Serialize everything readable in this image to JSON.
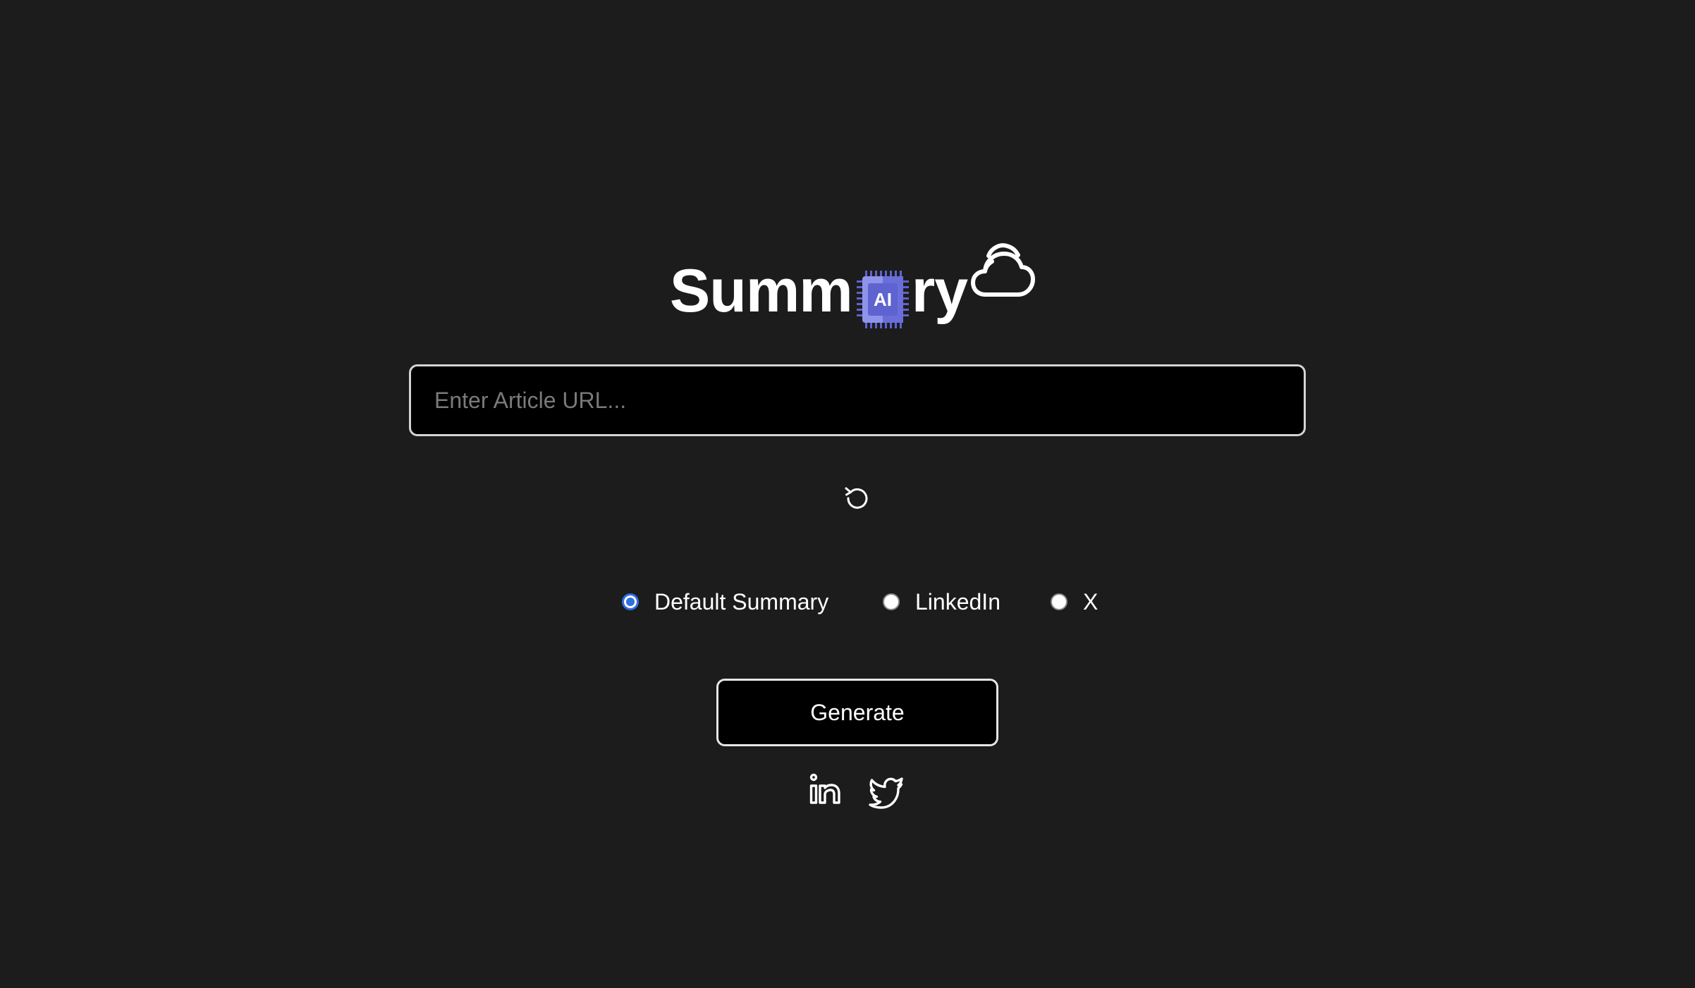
{
  "app": {
    "title_prefix": "Summ",
    "title_chip": "AI",
    "title_suffix": "ry",
    "colors": {
      "background": "#1c1c1c",
      "chip_light": "#8f93ea",
      "chip_dark": "#5f63d0",
      "radio_accent": "#2f6fe0"
    }
  },
  "url_input": {
    "placeholder": "Enter Article URL...",
    "value": ""
  },
  "reset": {
    "icon": "reset-icon"
  },
  "options": [
    {
      "label": "Default Summary",
      "checked": true
    },
    {
      "label": "LinkedIn",
      "checked": false
    },
    {
      "label": "X",
      "checked": false
    }
  ],
  "generate": {
    "label": "Generate"
  },
  "socials": [
    {
      "icon": "linkedin-icon"
    },
    {
      "icon": "twitter-icon"
    }
  ]
}
